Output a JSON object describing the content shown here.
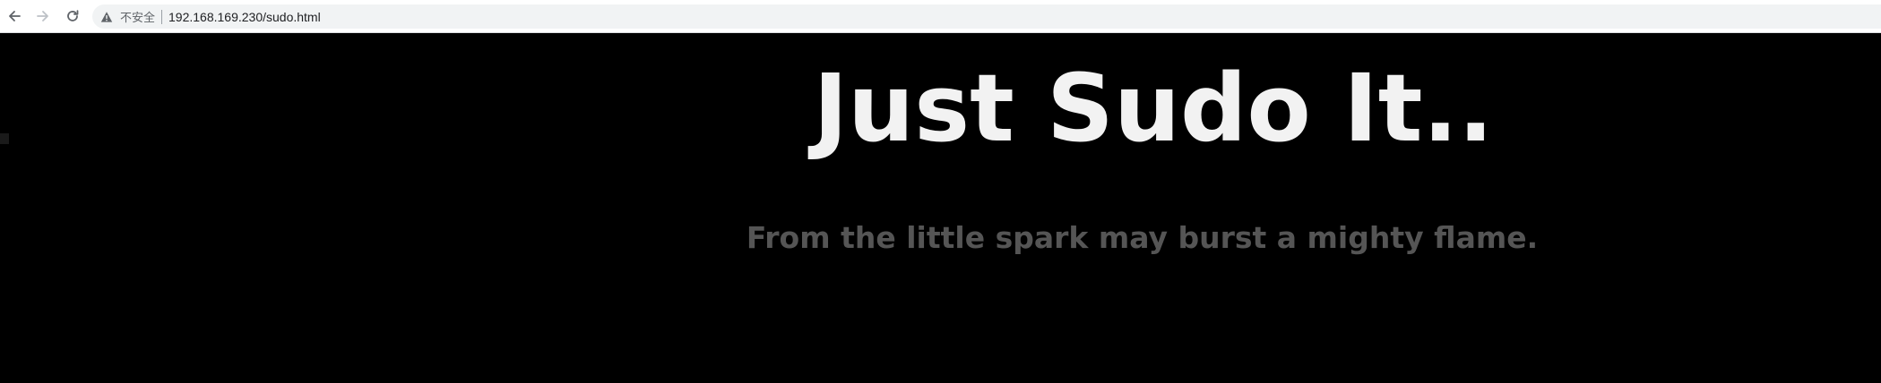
{
  "browser": {
    "security_label": "不安全",
    "url": "192.168.169.230/sudo.html",
    "icons": {
      "back": "arrow-left-icon",
      "forward": "arrow-right-icon",
      "reload": "reload-icon",
      "security": "warning-triangle-icon"
    }
  },
  "page": {
    "title": "Just Sudo It..",
    "tagline": "From the little spark may burst a mighty flame."
  },
  "colors": {
    "background": "#000000",
    "title": "#f2f2f2",
    "tagline": "#555555"
  }
}
